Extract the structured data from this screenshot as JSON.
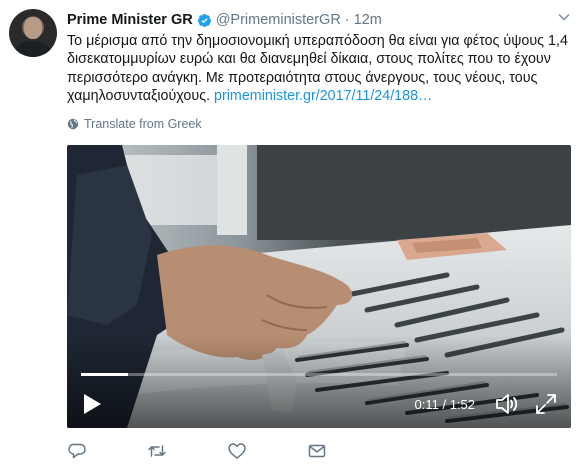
{
  "tweet": {
    "author_name": "Prime Minister GR",
    "handle": "@PrimeministerGR",
    "separator": "·",
    "time": "12m",
    "text": "Το μέρισμα από την δημοσιονομική υπεραπόδοση θα είναι για φέτος ύψους 1,4 δισεκατομμυρίων ευρώ και θα διανεμηθεί δίκαια, στους πολίτες που το έχουν περισσότερο ανάγκη. Με προτεραιότητα στους άνεργους, τους νέους, τους χαμηλοσυνταξιούχους.",
    "link": "primeminister.gr/2017/11/24/188…",
    "translate_label": "Translate from Greek"
  },
  "video": {
    "elapsed": "0:11",
    "duration": "1:52",
    "time_separator": " / ",
    "progress": 0.098
  },
  "icons": {
    "verified": "verified-badge-icon",
    "caret": "chevron-down-icon",
    "globe": "globe-icon",
    "play": "play-icon",
    "volume": "volume-icon",
    "fullscreen": "fullscreen-icon",
    "reply": "reply-icon",
    "retweet": "retweet-icon",
    "like": "heart-icon",
    "message": "direct-message-icon"
  },
  "colors": {
    "link": "#1b95e0",
    "verified": "#1da1f2",
    "secondary_text": "#657786",
    "action_icon": "#657786"
  }
}
